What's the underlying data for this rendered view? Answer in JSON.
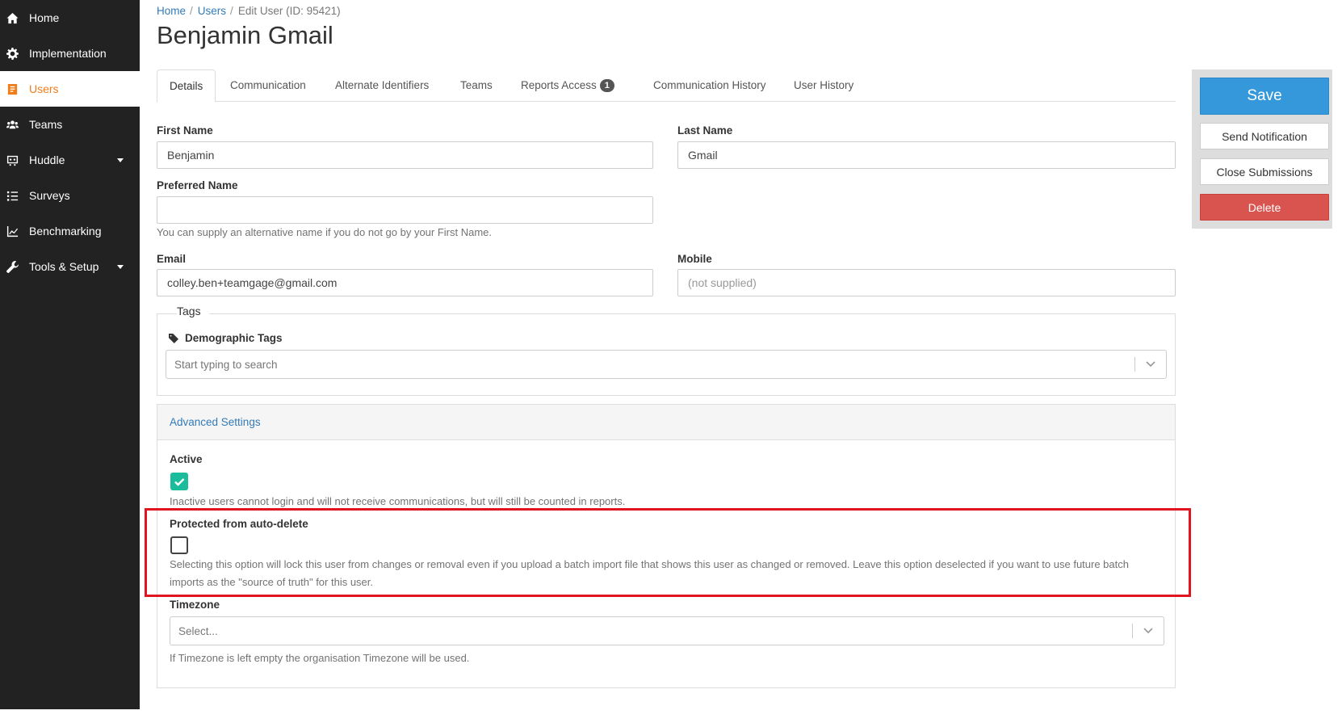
{
  "sidebar": {
    "items": [
      {
        "label": "Home",
        "icon": "home-icon"
      },
      {
        "label": "Implementation",
        "icon": "gear-icon"
      },
      {
        "label": "Users",
        "icon": "user-badge-icon",
        "active": true
      },
      {
        "label": "Teams",
        "icon": "team-icon"
      },
      {
        "label": "Huddle",
        "icon": "huddle-icon",
        "dropdown": true
      },
      {
        "label": "Surveys",
        "icon": "list-icon"
      },
      {
        "label": "Benchmarking",
        "icon": "chart-icon"
      },
      {
        "label": "Tools & Setup",
        "icon": "wrench-icon",
        "dropdown": true
      }
    ]
  },
  "breadcrumb": {
    "home": "Home",
    "users": "Users",
    "current": "Edit User (ID: 95421)"
  },
  "page": {
    "title": "Benjamin Gmail"
  },
  "tabs": [
    {
      "label": "Details",
      "active": true
    },
    {
      "label": "Communication"
    },
    {
      "label": "Alternate Identifiers"
    },
    {
      "label": "Teams"
    },
    {
      "label": "Reports Access",
      "badge": "1"
    },
    {
      "label": "Communication History"
    },
    {
      "label": "User History"
    }
  ],
  "form": {
    "first_name": {
      "label": "First Name",
      "value": "Benjamin"
    },
    "last_name": {
      "label": "Last Name",
      "value": "Gmail"
    },
    "preferred_name": {
      "label": "Preferred Name",
      "value": "",
      "help": "You can supply an alternative name if you do not go by your First Name."
    },
    "email": {
      "label": "Email",
      "value": "colley.ben+teamgage@gmail.com"
    },
    "mobile": {
      "label": "Mobile",
      "value": "(not supplied)"
    },
    "tags": {
      "legend": "Tags",
      "demographic_label": "Demographic Tags",
      "placeholder": "Start typing to search"
    },
    "advanced": {
      "title": "Advanced Settings",
      "active": {
        "label": "Active",
        "checked": true,
        "help": "Inactive users cannot login and will not receive communications, but will still be counted in reports."
      },
      "protected": {
        "label": "Protected from auto-delete",
        "checked": false,
        "help": "Selecting this option will lock this user from changes or removal even if you upload a batch import file that shows this user as changed or removed. Leave this option deselected if you want to use future batch imports as the \"source of truth\" for this user."
      },
      "timezone": {
        "label": "Timezone",
        "placeholder": "Select...",
        "help": "If Timezone is left empty the organisation Timezone will be used."
      }
    }
  },
  "actions": {
    "save": "Save",
    "send_notification": "Send Notification",
    "close_submissions": "Close Submissions",
    "delete": "Delete"
  },
  "colors": {
    "sidebar_bg": "#222222",
    "accent_orange": "#f07d1a",
    "save_blue": "#3498db",
    "delete_red": "#d9534f",
    "check_green": "#1abc9c",
    "highlight_red": "#e0151f"
  }
}
